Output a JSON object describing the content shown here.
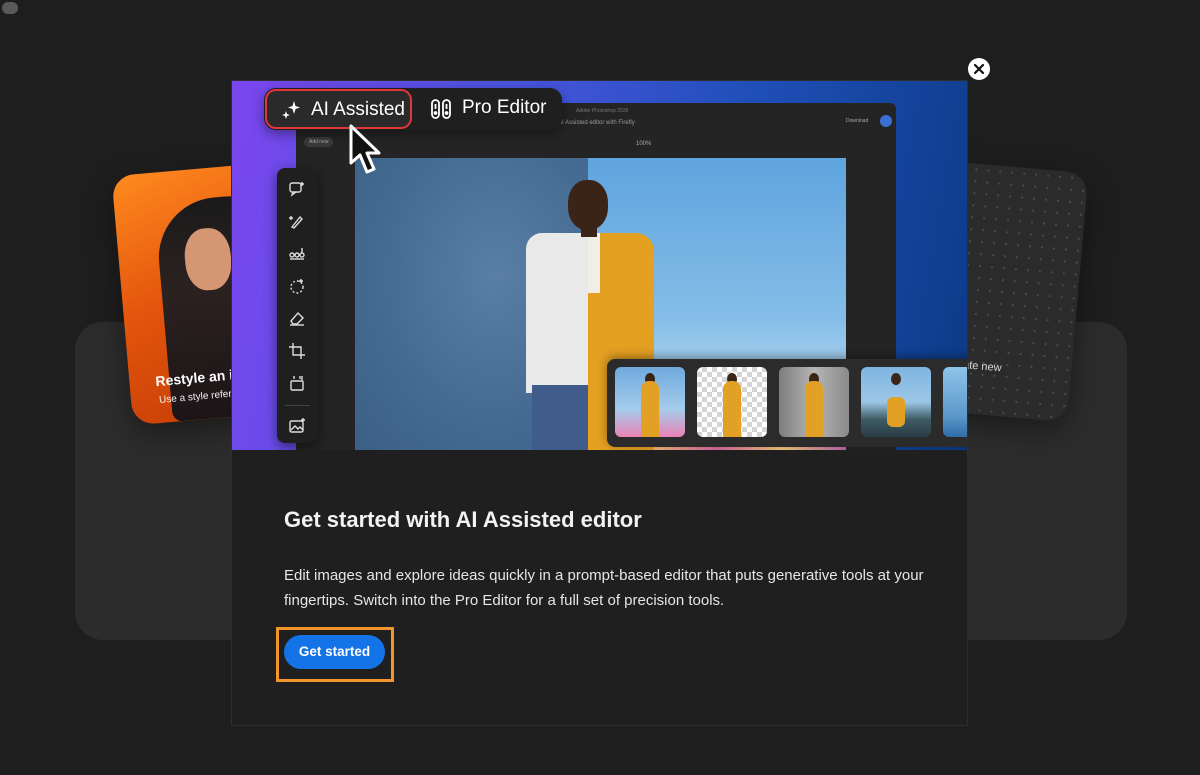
{
  "background_cards": {
    "left": {
      "title": "Restyle an im",
      "subtitle": "Use a style refere"
    },
    "right": {
      "title": "erate new"
    }
  },
  "modal": {
    "hero": {
      "mode_switch": {
        "ai_assisted_label": "AI Assisted",
        "pro_editor_label": "Pro Editor",
        "active": "AI Assisted"
      },
      "app_preview": {
        "window_title": "Adobe Photoshop 2026",
        "doc_title": "AI Assisted editor with Firefly",
        "zoom": "100%",
        "add_new": "Add new",
        "download": "Download"
      }
    },
    "title": "Get started with AI Assisted editor",
    "description": "Edit images and explore ideas quickly in a prompt-based editor that puts generative tools at your fingertips. Switch into the Pro Editor for a full set of precision tools.",
    "cta_label": "Get started"
  },
  "colors": {
    "accent_blue": "#1473e6",
    "highlight_orange": "#f0962a",
    "active_mode_border": "#e0383a"
  }
}
